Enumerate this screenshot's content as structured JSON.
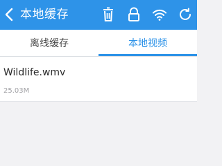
{
  "header": {
    "title": "本地缓存",
    "background": "#2e93e8",
    "icons": [
      "back-arrow-icon",
      "trash-icon",
      "lock-icon",
      "wifi-icon",
      "refresh-icon"
    ]
  },
  "tabs": [
    {
      "label": "离线缓存",
      "active": false
    },
    {
      "label": "本地视频",
      "active": true
    }
  ],
  "accent_color": "#2e93e8",
  "files": [
    {
      "name": "Wildlife.wmv",
      "size": "25.03M"
    }
  ]
}
